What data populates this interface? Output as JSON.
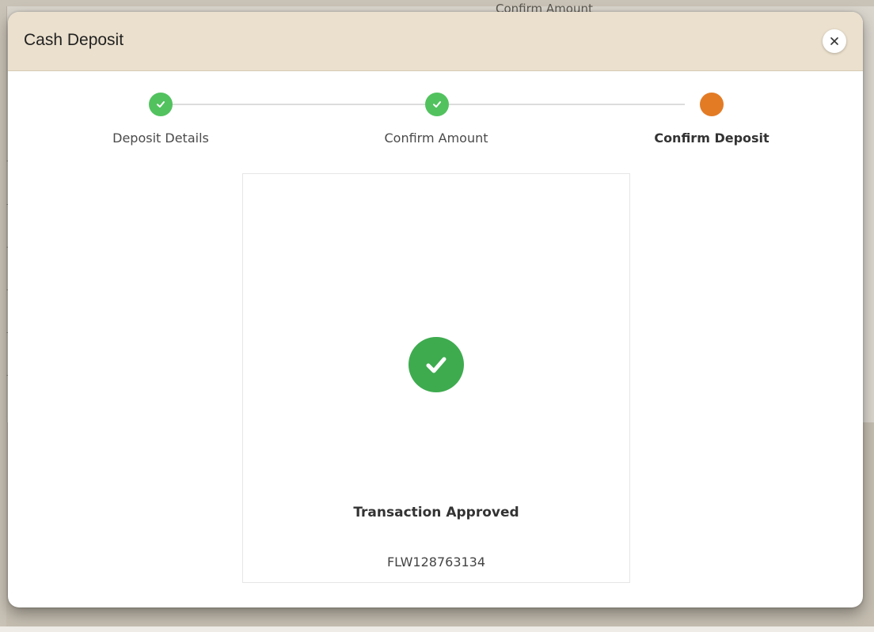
{
  "background": {
    "partial_step_label": "Confirm Amount"
  },
  "modal": {
    "title": "Cash Deposit",
    "close_icon": "close-icon",
    "header_color": "#ebe0cd"
  },
  "stepper": {
    "steps": [
      {
        "label": "Deposit Details",
        "status": "completed"
      },
      {
        "label": "Confirm Amount",
        "status": "completed"
      },
      {
        "label": "Confirm Deposit",
        "status": "active"
      }
    ],
    "completed_color": "#52c25f",
    "active_color": "#e37b25"
  },
  "result": {
    "icon": "check-circle-icon",
    "status_text": "Transaction Approved",
    "reference": "FLW128763134",
    "icon_color": "#3eab4f"
  }
}
